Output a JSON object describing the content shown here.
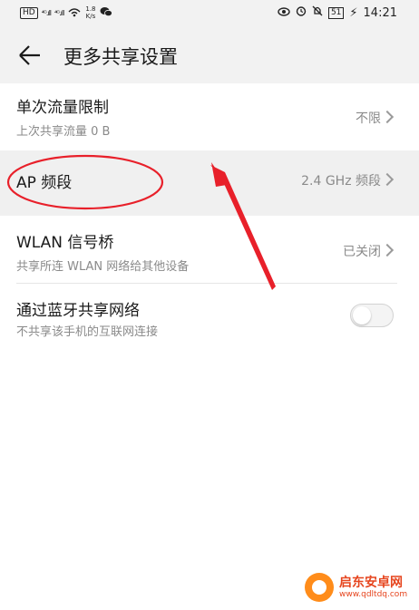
{
  "status_bar": {
    "left_chip": "HD",
    "sig1": "⁴ᴳ.ıll",
    "sig2": "⁴ᴳ.ıll",
    "speed_value": "1.8",
    "speed_unit": "K/s",
    "battery": "51",
    "time": "14:21"
  },
  "header": {
    "title": "更多共享设置"
  },
  "settings": [
    {
      "title": "单次流量限制",
      "subtitle": "上次共享流量 0 B",
      "value": "不限"
    },
    {
      "title": "AP 频段",
      "value": "2.4 GHz 频段"
    },
    {
      "title": "WLAN 信号桥",
      "subtitle": "共享所连 WLAN 网络给其他设备",
      "value": "已关闭"
    },
    {
      "title": "通过蓝牙共享网络",
      "subtitle": "不共享该手机的互联网连接",
      "toggle_on": false
    }
  ],
  "watermark": {
    "name": "启东安卓网",
    "url": "www.qdltdq.com"
  },
  "colors": {
    "highlight_bg": "#f0f0f0",
    "annotation_red": "#e8202a",
    "watermark_orange": "#ff8c1a"
  }
}
